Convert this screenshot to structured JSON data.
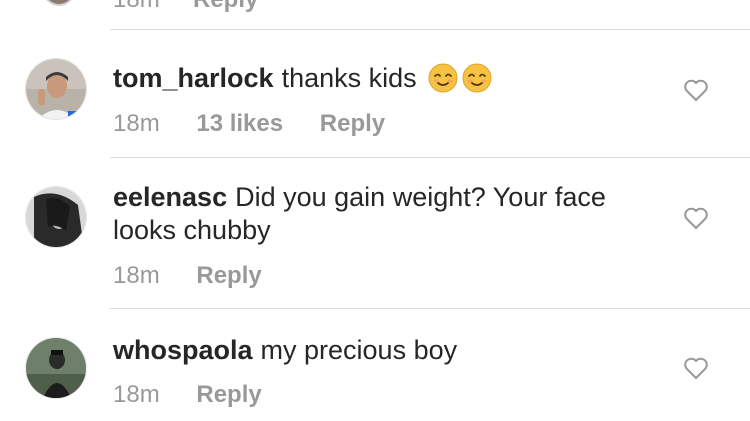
{
  "previous_comment": {
    "time": "18m",
    "reply_label": "Reply"
  },
  "comments": [
    {
      "username": "tom_harlock",
      "text": "thanks kids",
      "emoji": [
        "relieved-face",
        "relieved-face"
      ],
      "time": "18m",
      "likes": "13 likes",
      "reply_label": "Reply"
    },
    {
      "username": "eelenasc",
      "text": "Did you gain weight? Your face looks chubby",
      "time": "18m",
      "reply_label": "Reply"
    },
    {
      "username": "whospaola",
      "text": "my precious boy",
      "time": "18m",
      "reply_label": "Reply"
    }
  ],
  "colors": {
    "text": "#262626",
    "meta": "#999999",
    "divider": "#dbdbdb",
    "heart_outline": "#999999"
  }
}
